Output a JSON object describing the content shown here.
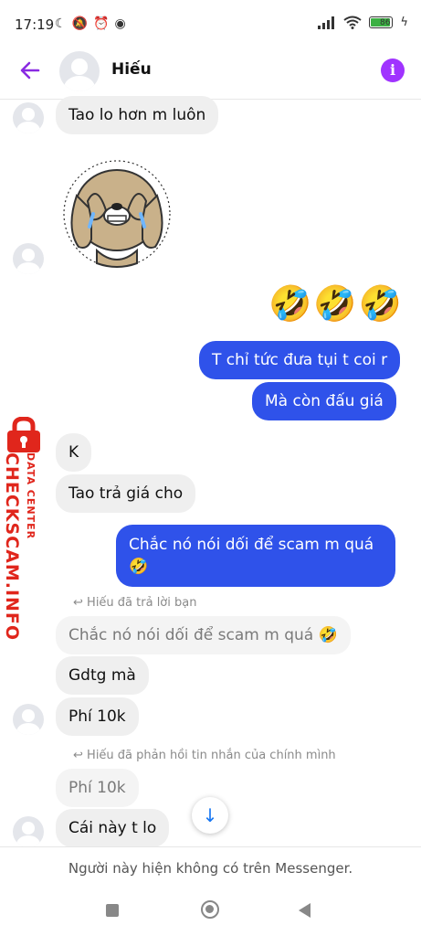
{
  "status_bar": {
    "time": "17:19",
    "battery": "86"
  },
  "header": {
    "contact_name": "Hiếu",
    "info_label": "i"
  },
  "messages": {
    "m1": "Tao lo hơn m luôn",
    "emoji_row": "🤣🤣🤣",
    "m2": "T chỉ tức đưa tụi t coi r",
    "m3": "Mà còn đấu giá",
    "m4": "K",
    "m5": "Tao trả giá cho",
    "m6": "Chắc nó nói dối để scam m quá 🤣",
    "reply_note_1": "Hiếu đã trả lời bạn",
    "quoted_1": "Chắc nó nói dối để scam m quá 🤣",
    "m7": "Gdtg mà",
    "m8": "Phí 10k",
    "reply_note_2": "Hiếu đã phản hồi tin nhắn của chính mình",
    "quoted_2": "Phí 10k",
    "m9": "Cái này t lo"
  },
  "footer": {
    "notice": "Người này hiện không có trên Messenger."
  },
  "watermark": {
    "line1": "DATA CENTER",
    "line2": "CHECKSCAM.INFO"
  },
  "colors": {
    "accent": "#a033ff",
    "outgoing_bubble": "#2f52ea",
    "incoming_bubble": "#efefef",
    "watermark": "#e0261c"
  }
}
